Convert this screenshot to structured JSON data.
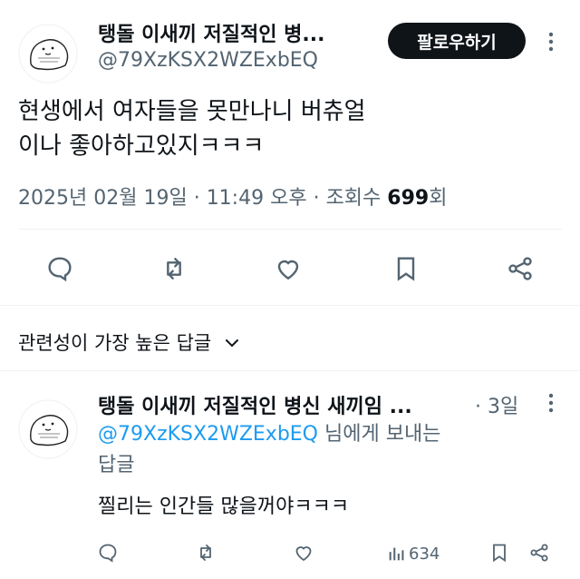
{
  "post": {
    "author_name": "탱돌 이새끼 저질적인 병...",
    "author_handle": "@79XzKSX2WZExbEQ",
    "follow_label": "팔로우하기",
    "more_label": "⋮",
    "text_line1": "현생에서 여자들을 못만나니 버츄얼",
    "text_line2": "이나 좋아하고있지ㅋㅋㅋ",
    "date": "2025년 02월 19일",
    "sep1": "·",
    "time": "11:49 오후",
    "sep2": "·",
    "views_label": "조회수",
    "views_count": "699",
    "views_unit": "회"
  },
  "actions": [
    "reply-icon",
    "retweet-icon",
    "like-icon",
    "bookmark-icon",
    "share-icon"
  ],
  "sort": {
    "label": "관련성이 가장 높은 답글",
    "chevron": "⌄"
  },
  "reply": {
    "author_name": "탱돌 이새끼 저질적인 병신 새끼임 ...",
    "time": "· 3일",
    "more_label": "⋮",
    "mention": "@79XzKSX2WZExbEQ",
    "to_suffix": " 님에게 보내는",
    "to_line2": "답글",
    "text": "찔리는 인간들 많을꺼야ㅋㅋㅋ",
    "views": "634"
  },
  "colors": {
    "text": "#0f1419",
    "muted": "#536471",
    "link": "#1d9bf0",
    "button_bg": "#0f1419"
  }
}
